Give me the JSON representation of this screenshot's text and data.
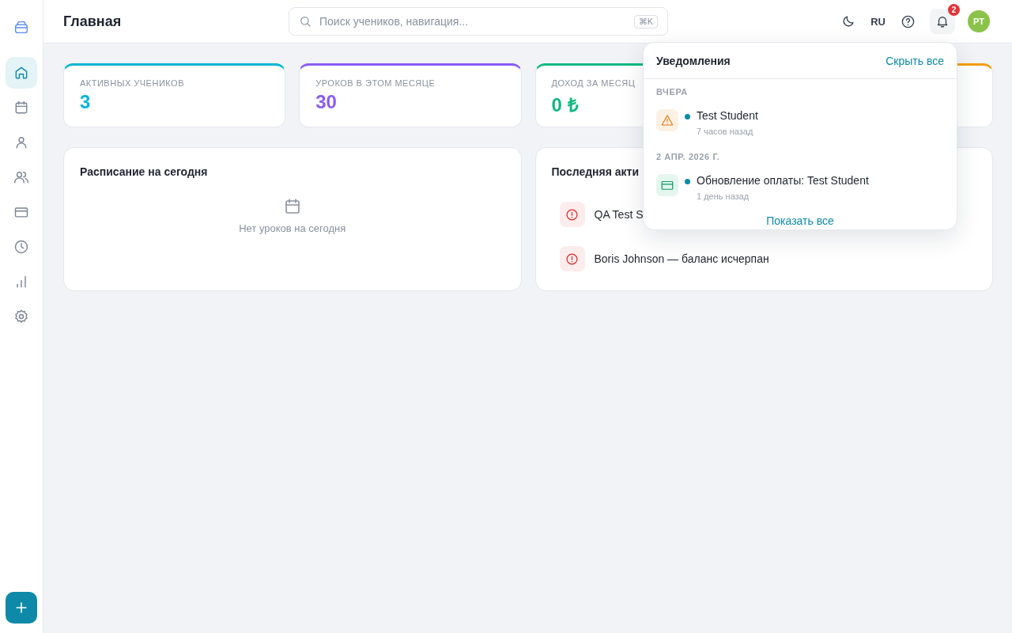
{
  "sidebar": {
    "items": [
      {
        "kind": "home",
        "selected": true
      },
      {
        "kind": "calendar",
        "selected": false
      },
      {
        "kind": "user",
        "selected": false
      },
      {
        "kind": "users",
        "selected": false
      },
      {
        "kind": "card",
        "selected": false
      },
      {
        "kind": "clock",
        "selected": false
      },
      {
        "kind": "chart",
        "selected": false
      },
      {
        "kind": "settings",
        "selected": false
      }
    ]
  },
  "header": {
    "title": "Главная",
    "search": {
      "placeholder": "Поиск учеников, навигация...",
      "shortcut": "⌘K"
    },
    "language": "RU",
    "notification_count": "2",
    "avatar": "PT"
  },
  "stats": [
    {
      "label": "АКТИВНЫХ УЧЕНИКОВ",
      "value": "3",
      "color": "#06b6d4"
    },
    {
      "label": "УРОКОВ В ЭТОМ МЕСЯЦЕ",
      "value": "30",
      "color": "#8b5cf6"
    },
    {
      "label": "ДОХОД ЗА МЕСЯЦ",
      "value": "0 ₺",
      "color": "#10b981"
    },
    {
      "color": "#f59e0b"
    }
  ],
  "schedule": {
    "title": "Расписание на сегодня",
    "empty": "Нет уроков на сегодня"
  },
  "activity": {
    "title": "Последняя акти",
    "items": [
      {
        "kind": "alert",
        "text": "QA Test S"
      },
      {
        "kind": "alert",
        "text": "Boris Johnson — баланс исчерпан"
      }
    ]
  },
  "notifications": {
    "title": "Уведомления",
    "hide_all": "Скрыть все",
    "groups": [
      {
        "date": "ВЧЕРА",
        "items": [
          {
            "kind": "warning",
            "title": "Test Student",
            "time": "7 часов назад",
            "unread": true
          }
        ]
      },
      {
        "date": "2 АПР. 2026 Г.",
        "items": [
          {
            "kind": "payment",
            "title": "Обновление оплаты: Test Student",
            "time": "1 день назад",
            "unread": true
          }
        ]
      }
    ],
    "show_all": "Показать все"
  }
}
